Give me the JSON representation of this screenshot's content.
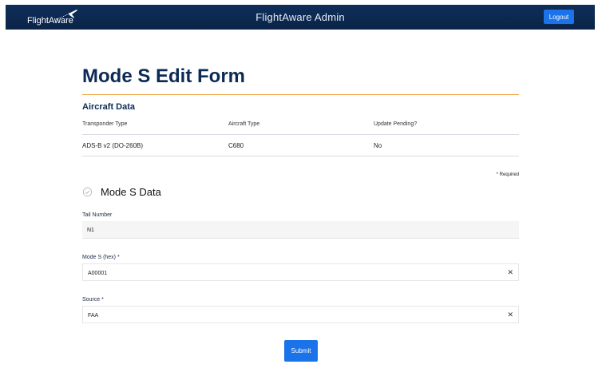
{
  "header": {
    "logo_text": "FlightAware",
    "app_title": "FlightAware Admin",
    "logout_label": "Logout"
  },
  "page": {
    "title": "Mode S Edit Form"
  },
  "aircraft_data": {
    "title": "Aircraft Data",
    "columns": [
      "Transponder Type",
      "Aircraft Type",
      "Update Pending?"
    ],
    "values": [
      "ADS-B v2 (DO-260B)",
      "C680",
      "No"
    ]
  },
  "required_note": "* Required",
  "mode_s": {
    "title": "Mode S Data",
    "status_icon": "check-circle-icon",
    "fields": [
      {
        "label": "Tail Number",
        "value": "N1"
      },
      {
        "label": "Mode S (hex) *",
        "value": "A00001",
        "clear_icon": "close-icon"
      },
      {
        "label": "Source *",
        "value": "FAA",
        "clear_icon": "close-icon"
      }
    ]
  },
  "submit_label": "Submit",
  "colors": {
    "header_bg": "#0d2c55",
    "accent_button": "#1a73e8",
    "title_rule": "#f0a648",
    "title_text": "#0b2a55"
  }
}
